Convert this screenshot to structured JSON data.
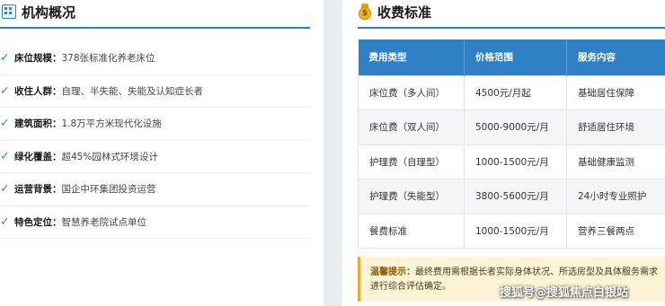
{
  "left": {
    "title": "机构概况",
    "icon": "building-icon",
    "items": [
      {
        "label": "床位规模：",
        "value": "378张标准化养老床位"
      },
      {
        "label": "收住人群：",
        "value": "自理、半失能、失能及认知症长者"
      },
      {
        "label": "建筑面积：",
        "value": "1.8万平方米现代化设施"
      },
      {
        "label": "绿化覆盖：",
        "value": "超45%园林式环境设计"
      },
      {
        "label": "运营背景：",
        "value": "国企中环集团投资运营"
      },
      {
        "label": "特色定位：",
        "value": "智慧养老院试点单位"
      }
    ]
  },
  "right": {
    "title": "收费标准",
    "icon": "money-bag-icon",
    "table": {
      "headers": [
        "费用类型",
        "价格范围",
        "服务内容"
      ],
      "rows": [
        [
          "床位费（多人间）",
          "4500元/月起",
          "基础居住保障"
        ],
        [
          "床位费（双人间）",
          "5000-9000元/月",
          "舒适居住环境"
        ],
        [
          "护理费（自理型）",
          "1000-1500元/月",
          "基础健康监测"
        ],
        [
          "护理费（失能型）",
          "3800-5600元/月",
          "24小时专业照护"
        ],
        [
          "餐费标准",
          "1000-1500元/月",
          "营养三餐两点"
        ]
      ]
    },
    "tip": {
      "label": "温馨提示：",
      "text": "最终费用需根据长者实际身体状况、所选房型及具体服务需求进行综合评估确定。"
    }
  },
  "watermark": "搜狐号@搜狐焦点白银站",
  "colors": {
    "accent": "#2f80c4",
    "check": "#2fa34a",
    "tip_bg": "#fdf3d6",
    "tip_border": "#f0a93b"
  }
}
